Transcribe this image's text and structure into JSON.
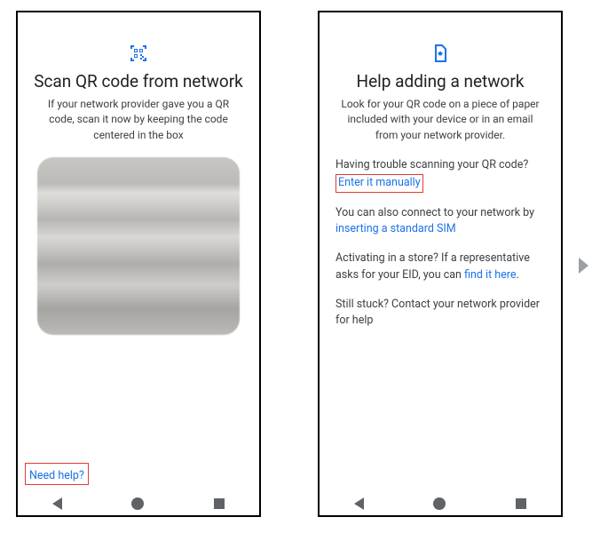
{
  "left": {
    "title": "Scan QR code from network",
    "subtitle": "If your network provider gave you a QR code, scan it now by keeping the code centered in the box",
    "need_help": "Need help?"
  },
  "right": {
    "title": "Help adding a network",
    "subtitle": "Look for your QR code on a piece of paper included with your device or in an email from your network provider.",
    "p1_prefix": "Having trouble scanning your QR code? ",
    "p1_link": "Enter it manually",
    "p2_prefix": "You can also connect to your network by ",
    "p2_link": "inserting a standard SIM",
    "p3_prefix": "Activating in a store? If a representative asks for your EID, you can ",
    "p3_link": "find it here",
    "p3_suffix": ".",
    "p4": "Still stuck? Contact your network provider for help"
  }
}
